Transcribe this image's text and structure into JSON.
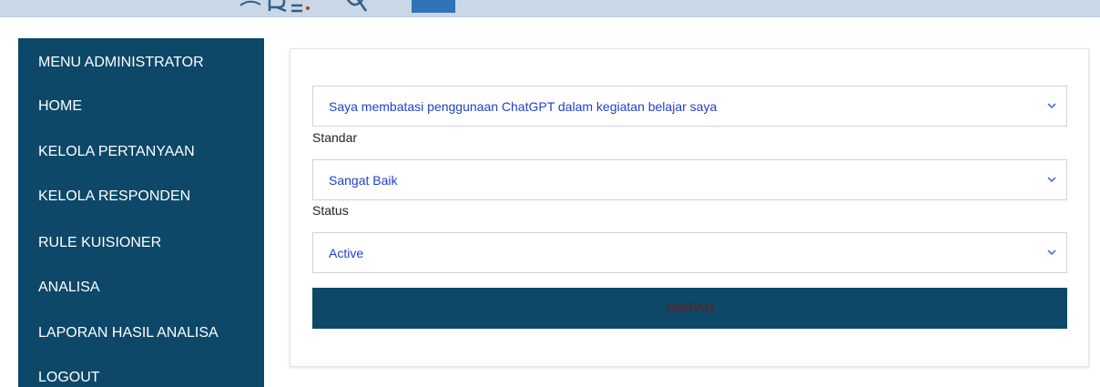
{
  "sidebar": {
    "items": [
      {
        "label": "MENU ADMINISTRATOR"
      },
      {
        "label": "HOME"
      },
      {
        "label": "KELOLA PERTANYAAN"
      },
      {
        "label": "KELOLA RESPONDEN"
      },
      {
        "label": "RULE KUISIONER"
      },
      {
        "label": "ANALISA"
      },
      {
        "label": "LAPORAN HASIL ANALISA"
      },
      {
        "label": "LOGOUT"
      }
    ],
    "background": "#0d4868",
    "text_color": "#ffffff"
  },
  "form": {
    "question_select": {
      "value": "Saya membatasi penggunaan ChatGPT dalam kegiatan belajar saya"
    },
    "standar": {
      "label": "Standar",
      "value": "Sangat Baik"
    },
    "status": {
      "label": "Status",
      "value": "Active"
    },
    "save_label": "SIMPAN",
    "select_text_color": "#1f3fd0",
    "button_color": "#0d4868",
    "button_text_color": "#6b1c1c"
  },
  "icons": {
    "dropdown": "chevron-down-icon",
    "banner": "logo-icon"
  }
}
